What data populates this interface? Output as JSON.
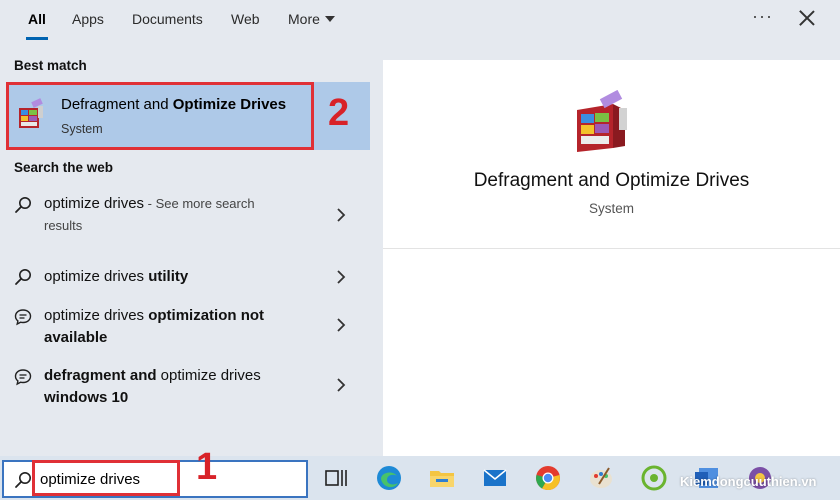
{
  "tabs": [
    {
      "label": "All"
    },
    {
      "label": "Apps"
    },
    {
      "label": "Documents"
    },
    {
      "label": "Web"
    },
    {
      "label": "More"
    }
  ],
  "header": {
    "more_options": "···"
  },
  "best_match": {
    "section_title": "Best match",
    "title_normal": "Defragment and ",
    "title_bold": "Optimize Drives",
    "subtitle": "System",
    "annotation": "2"
  },
  "web": {
    "section_title": "Search the web",
    "items": [
      {
        "normal": "optimize drives",
        "bold": "",
        "see_more": " - See more search",
        "line2": "results"
      },
      {
        "normal": "optimize drives ",
        "bold": "utility",
        "see_more": "",
        "line2": ""
      },
      {
        "normal": "optimize drives ",
        "bold": "optimization not",
        "see_more": "",
        "line2": "available"
      },
      {
        "bold_first": "defragment and",
        "normal": " optimize drives",
        "line2": "windows 10"
      }
    ]
  },
  "preview": {
    "title": "Defragment and Optimize Drives",
    "subtitle": "System"
  },
  "search": {
    "value": "optimize drives",
    "annotation": "1"
  },
  "watermark": "Kiemdongcuuthien.vn",
  "colors": {
    "accent": "#0063b1",
    "annotation_red": "#e03036",
    "selected_bg": "#aec9e8"
  }
}
